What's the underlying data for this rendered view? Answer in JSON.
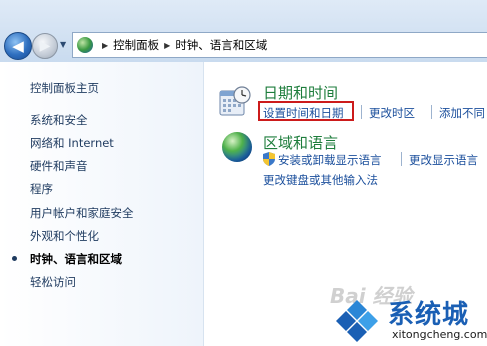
{
  "address_bar": {
    "breadcrumbs": [
      "控制面板",
      "时钟、语言和区域"
    ]
  },
  "sidebar": {
    "home": "控制面板主页",
    "items": [
      {
        "label": "系统和安全"
      },
      {
        "label": "网络和 Internet"
      },
      {
        "label": "硬件和声音"
      },
      {
        "label": "程序"
      },
      {
        "label": "用户帐户和家庭安全"
      },
      {
        "label": "外观和个性化"
      },
      {
        "label": "时钟、语言和区域",
        "current": true
      },
      {
        "label": "轻松访问"
      }
    ]
  },
  "main": {
    "categories": [
      {
        "title": "日期和时间",
        "links": [
          "设置时间和日期",
          "更改时区",
          "添加不同"
        ]
      },
      {
        "title": "区域和语言",
        "links": [
          "安装或卸载显示语言",
          "更改显示语言",
          "更改键盘或其他输入法"
        ]
      }
    ]
  },
  "watermark": {
    "baidu": "Bai 经验",
    "brand": "系统城",
    "url": "xitongcheng.com"
  },
  "colors": {
    "link": "#1b4f9c",
    "category_title": "#1e7d3c",
    "highlight": "#cc1b1b",
    "brand": "#1a5fb4"
  }
}
